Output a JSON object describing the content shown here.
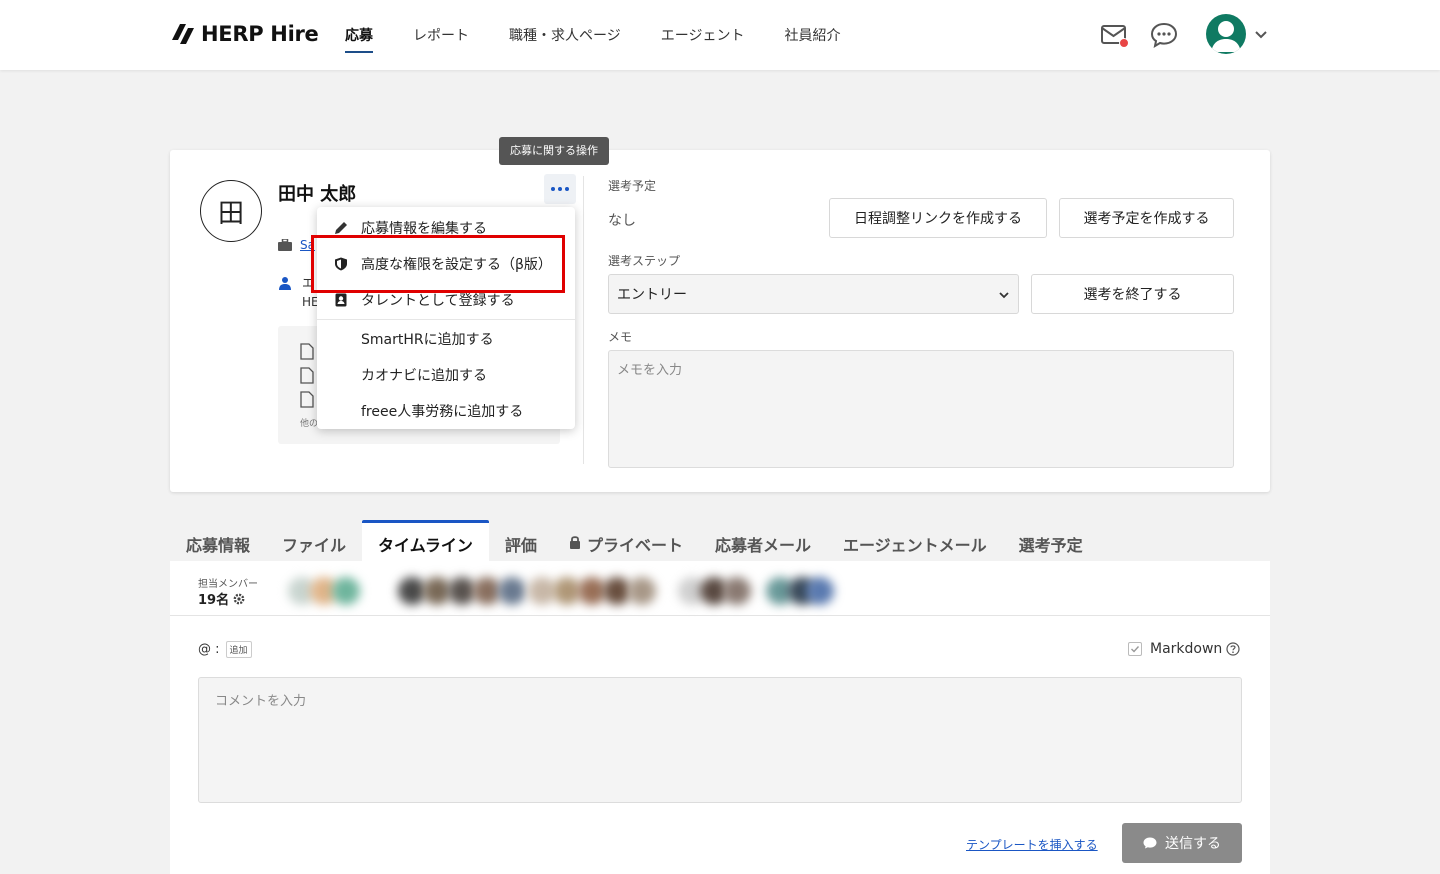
{
  "header": {
    "logo_text": "HERP Hire",
    "nav": [
      {
        "label": "応募",
        "active": true
      },
      {
        "label": "レポート"
      },
      {
        "label": "職種・求人ページ"
      },
      {
        "label": "エージェント"
      },
      {
        "label": "社員紹介"
      }
    ]
  },
  "candidate": {
    "avatar_char": "田",
    "name": "田中 太郎",
    "info_link_fragment": "Sa",
    "info_line2_fragment": "エ",
    "info_line3_fragment": "HE",
    "others_fragment": "他の"
  },
  "tooltip": "応募に関する操作",
  "menu": {
    "items": [
      {
        "label": "応募情報を編集する",
        "icon": "pencil-icon"
      },
      {
        "label": "高度な権限を設定する（β版）",
        "icon": "shield-icon"
      },
      {
        "label": "タレントとして登録する",
        "icon": "contact-card-icon"
      },
      {
        "label": "SmartHRに追加する"
      },
      {
        "label": "カオナビに追加する"
      },
      {
        "label": "freee人事労務に追加する"
      }
    ]
  },
  "schedule": {
    "label": "選考予定",
    "value": "なし",
    "btn_link": "日程調整リンクを作成する",
    "btn_create": "選考予定を作成する"
  },
  "step": {
    "label": "選考ステップ",
    "selected": "エントリー",
    "btn_end": "選考を終了する"
  },
  "memo": {
    "label": "メモ",
    "placeholder": "メモを入力"
  },
  "tabs": [
    {
      "label": "応募情報"
    },
    {
      "label": "ファイル"
    },
    {
      "label": "タイムライン",
      "active": true
    },
    {
      "label": "評価"
    },
    {
      "label": "プライベート",
      "icon": "lock-icon"
    },
    {
      "label": "応募者メール"
    },
    {
      "label": "エージェントメール"
    },
    {
      "label": "選考予定"
    }
  ],
  "timeline": {
    "member_label": "担当メンバー",
    "member_count": "19名",
    "mention_prefix": "@ :",
    "add_label": "追加",
    "markdown_label": "Markdown",
    "comment_placeholder": "コメントを入力",
    "template_link": "テンプレートを挿入する",
    "send_label": "送信する"
  },
  "colors": {
    "accent": "#1a56c4",
    "highlight": "#e00000",
    "notification": "#e84545",
    "avatar_bg": "#0f7a62"
  }
}
